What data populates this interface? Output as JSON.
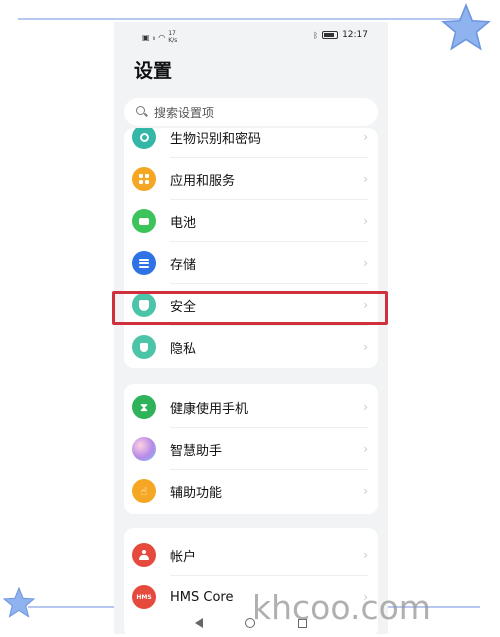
{
  "status_bar": {
    "left_glyphs": [
      "▣",
      "ᵃᶦ",
      "📶"
    ],
    "signal_text": "¹⁷ₖ/ₛ",
    "time": "12:17"
  },
  "settings": {
    "title": "设置",
    "search_placeholder": "搜索设置项",
    "groups": [
      {
        "items": [
          {
            "label": "生物识别和密码",
            "icon": "key-icon",
            "color": "#34b7a7"
          },
          {
            "label": "应用和服务",
            "icon": "apps-icon",
            "color": "#f5a623"
          },
          {
            "label": "电池",
            "icon": "battery-icon",
            "color": "#3cc45a"
          },
          {
            "label": "存储",
            "icon": "storage-icon",
            "color": "#2e73e6"
          },
          {
            "label": "安全",
            "icon": "shield-icon",
            "color": "#4cc4a8"
          },
          {
            "label": "隐私",
            "icon": "privacy-icon",
            "color": "#4cc4a8"
          }
        ]
      },
      {
        "items": [
          {
            "label": "健康使用手机",
            "icon": "hourglass-icon",
            "color": "#2fb35a"
          },
          {
            "label": "智慧助手",
            "icon": "assistant-icon",
            "color": "#b58ae8"
          },
          {
            "label": "辅助功能",
            "icon": "hand-icon",
            "color": "#f5a623"
          }
        ]
      },
      {
        "items": [
          {
            "label": "帐户",
            "icon": "account-icon",
            "color": "#e54a3c"
          },
          {
            "label": "HMS Core",
            "icon": "hms-icon",
            "color": "#e54a3c",
            "icon_text": "HMS"
          }
        ]
      }
    ],
    "chevron": "›"
  },
  "watermark": "khcoo.com",
  "colors": {
    "highlight": "#d0303c",
    "frame": "#b6c8f0",
    "star": "#8fb3ee"
  }
}
